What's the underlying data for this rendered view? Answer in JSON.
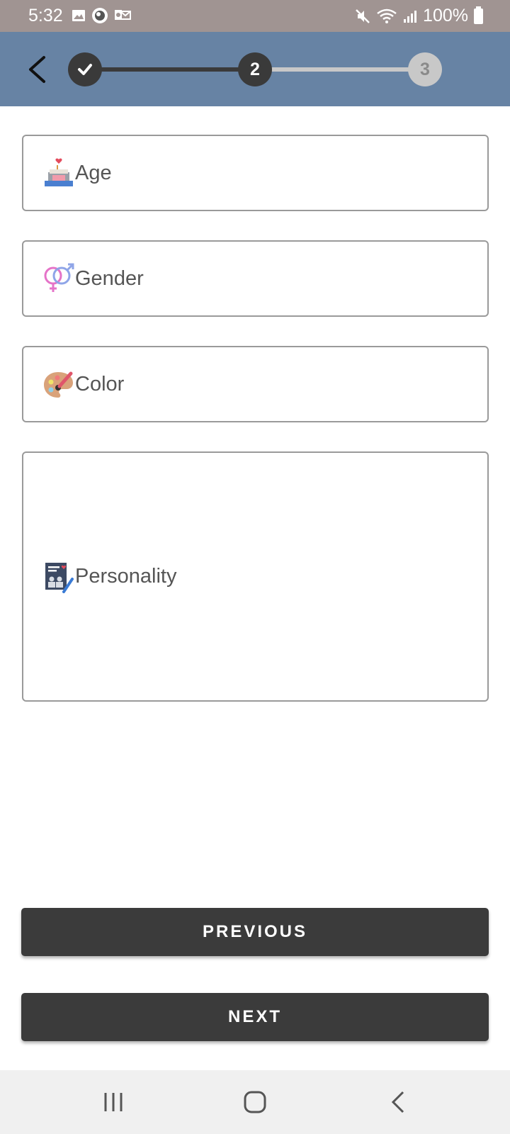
{
  "status_bar": {
    "time": "5:32",
    "battery": "100%",
    "left_icons": [
      "gallery-icon",
      "app-notification-icon",
      "outlook-icon"
    ],
    "right_icons": [
      "mute-icon",
      "wifi-icon",
      "signal-icon",
      "battery-icon"
    ]
  },
  "stepper": {
    "steps": [
      {
        "label": "",
        "state": "done"
      },
      {
        "label": "2",
        "state": "current"
      },
      {
        "label": "3",
        "state": "pending"
      }
    ],
    "colors": {
      "active": "#3a3a3a",
      "inactive": "#c8c8c8",
      "header_bg": "#6783a4"
    }
  },
  "form": {
    "fields": [
      {
        "id": "age",
        "label": "Age",
        "icon": "birthday-cake-icon"
      },
      {
        "id": "gender",
        "label": "Gender",
        "icon": "gender-symbol-icon"
      },
      {
        "id": "color",
        "label": "Color",
        "icon": "palette-icon"
      },
      {
        "id": "personality",
        "label": "Personality",
        "icon": "profile-card-icon"
      }
    ]
  },
  "buttons": {
    "previous": "PREVIOUS",
    "next": "NEXT"
  },
  "nav_bar": {
    "items": [
      "recents-icon",
      "home-icon",
      "back-icon"
    ]
  }
}
